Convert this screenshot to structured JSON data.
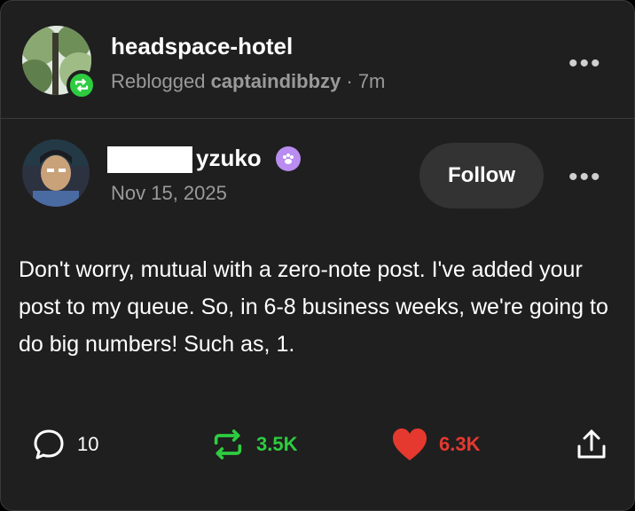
{
  "reblog": {
    "blog_name": "headspace-hotel",
    "prefix": "Reblogged",
    "source": "captaindibbzy",
    "time": "· 7m"
  },
  "post": {
    "author_visible": "yzuko",
    "date": "Nov 15, 2025",
    "follow_label": "Follow",
    "body": "Don't worry, mutual with a zero-note post. I've added your post to my queue. So, in 6-8 business weeks, we're going to do big numbers! Such as, 1."
  },
  "actions": {
    "comments": "10",
    "reblogs": "3.5K",
    "likes": "6.3K"
  },
  "colors": {
    "background": "#1f1f1f",
    "reblog_green": "#2ecc40",
    "like_red": "#e5392f",
    "muted_text": "#9a9a9a"
  },
  "icons": [
    "reblog-icon",
    "more-dots-icon",
    "paw-badge-icon",
    "comment-icon",
    "heart-icon",
    "share-icon"
  ]
}
